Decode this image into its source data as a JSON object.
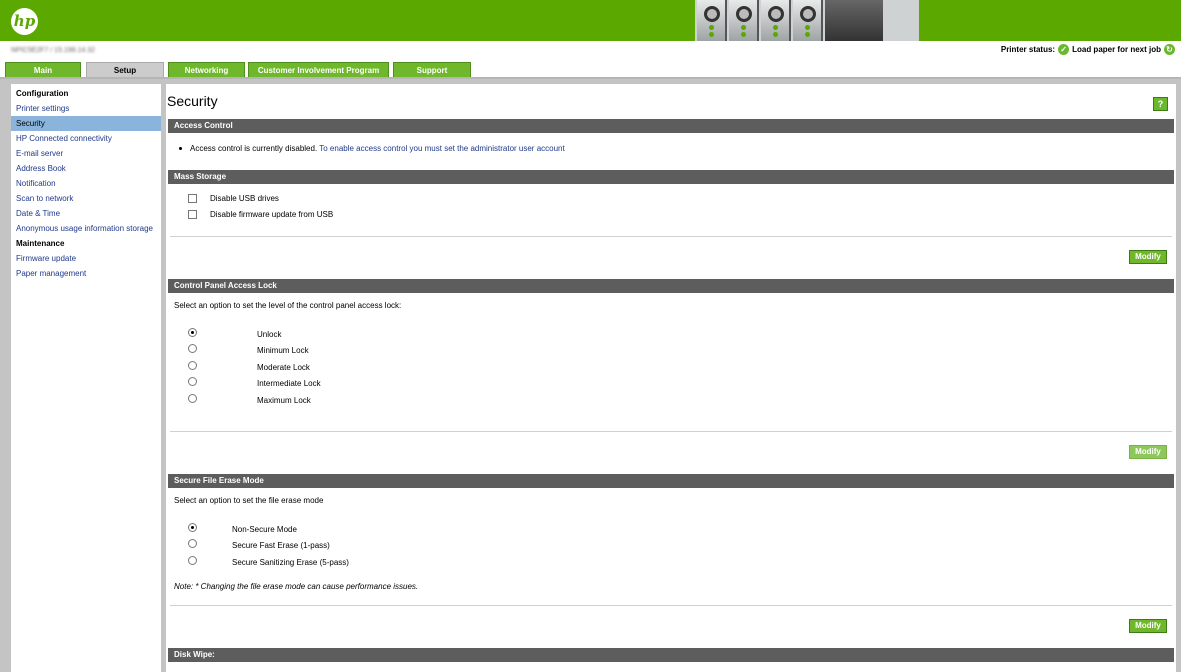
{
  "header": {
    "logo_text": "hp",
    "identity": "NPIC5E2F7 / 15.198.14.32",
    "status_label": "Printer status:",
    "status_text": "Load paper for next job"
  },
  "tabs": [
    {
      "label": "Main"
    },
    {
      "label": "Setup"
    },
    {
      "label": "Networking"
    },
    {
      "label": "Customer Involvement Program"
    },
    {
      "label": "Support"
    }
  ],
  "sidebar": {
    "items": [
      {
        "label": "Configuration"
      },
      {
        "label": "Printer settings"
      },
      {
        "label": "Security"
      },
      {
        "label": "HP Connected connectivity"
      },
      {
        "label": "E-mail server"
      },
      {
        "label": "Address Book"
      },
      {
        "label": "Notification"
      },
      {
        "label": "Scan to network"
      },
      {
        "label": "Date & Time"
      },
      {
        "label": "Anonymous usage information storage"
      },
      {
        "label": "Maintenance"
      },
      {
        "label": "Firmware update"
      },
      {
        "label": "Paper management"
      }
    ]
  },
  "page": {
    "title": "Security",
    "help_label": "?"
  },
  "access_control": {
    "heading": "Access Control",
    "text": "Access control is currently disabled.",
    "link": "To enable access control you must set the administrator user account"
  },
  "mass_storage": {
    "heading": "Mass Storage",
    "options": [
      {
        "label": "Disable USB drives"
      },
      {
        "label": "Disable firmware update from USB"
      }
    ],
    "modify_label": "Modify"
  },
  "panel_lock": {
    "heading": "Control Panel Access Lock",
    "instruction": "Select an option to set the level of the control panel access lock:",
    "options": [
      {
        "label": "Unlock"
      },
      {
        "label": "Minimum Lock"
      },
      {
        "label": "Moderate Lock"
      },
      {
        "label": "Intermediate Lock"
      },
      {
        "label": "Maximum Lock"
      }
    ],
    "selected": "Unlock",
    "modify_label": "Modify"
  },
  "erase_mode": {
    "heading": "Secure File Erase Mode",
    "instruction": "Select an option to set the file erase mode",
    "options": [
      {
        "label": "Non-Secure Mode"
      },
      {
        "label": "Secure Fast Erase (1-pass)"
      },
      {
        "label": "Secure Sanitizing Erase (5-pass)"
      }
    ],
    "selected": "Non-Secure Mode",
    "note": "Note: * Changing the file erase mode can cause performance issues.",
    "modify_label": "Modify"
  },
  "disk_wipe": {
    "heading": "Disk Wipe:"
  },
  "colors": {
    "brand_green": "#5aa800",
    "section_header": "#5d5d5d",
    "link_blue": "#1f3a8a",
    "selected_nav": "#8bb4dc"
  }
}
